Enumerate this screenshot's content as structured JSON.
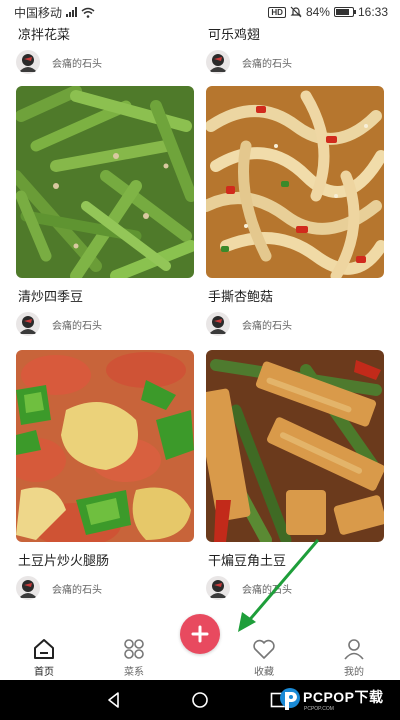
{
  "status_bar": {
    "carrier": "中国移动",
    "network_badge": "HD",
    "battery_percent": "84%",
    "battery_level": 0.84,
    "time": "16:33"
  },
  "recipes": [
    {
      "title": "凉拌花菜",
      "author": "会痛的石头",
      "image": "cauliflower-dish-photo"
    },
    {
      "title": "可乐鸡翅",
      "author": "会痛的石头",
      "image": "cola-chicken-wings-photo"
    },
    {
      "title": "清炒四季豆",
      "author": "会痛的石头",
      "image": "stir-fried-green-beans-photo"
    },
    {
      "title": "手撕杏鲍菇",
      "author": "会痛的石头",
      "image": "shredded-king-oyster-mushroom-photo"
    },
    {
      "title": "土豆片炒火腿肠",
      "author": "会痛的石头",
      "image": "potato-ham-sausage-stir-fry-photo"
    },
    {
      "title": "干煸豆角土豆",
      "author": "会痛的石头",
      "image": "dry-fried-beans-potato-photo"
    }
  ],
  "bottom_nav": {
    "items": [
      {
        "label": "首页",
        "icon": "home-icon",
        "active": true
      },
      {
        "label": "菜系",
        "icon": "category-grid-icon",
        "active": false
      },
      {
        "label": "收藏",
        "icon": "heart-icon",
        "active": false
      },
      {
        "label": "我的",
        "icon": "person-icon",
        "active": false
      }
    ],
    "fab_icon": "plus-icon"
  },
  "watermark": {
    "text": "PCPOP下载",
    "subtext": "PCPOP.COM"
  },
  "colors": {
    "accent": "#e84a5f",
    "annotation_arrow": "#1e9e3a",
    "text_primary": "#222222",
    "text_secondary": "#666666"
  }
}
